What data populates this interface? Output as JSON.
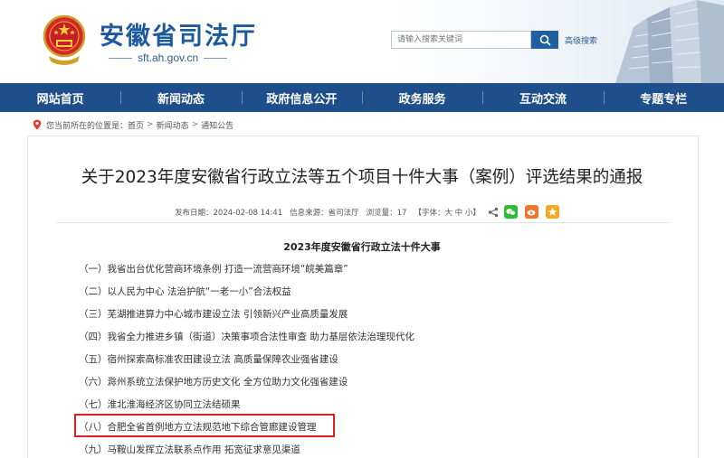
{
  "header": {
    "site_title": "安徽省司法厅",
    "site_url": "sft.ah.gov.cn",
    "search_placeholder": "请输入搜索关键词",
    "advanced_search": "高级搜索"
  },
  "nav": {
    "items": [
      "网站首页",
      "新闻动态",
      "政府信息公开",
      "政务服务",
      "互动交流",
      "专题专栏"
    ]
  },
  "breadcrumb": {
    "prefix": "您当前所在的位置是：",
    "items": [
      "首页",
      "新闻动态",
      "通知公告"
    ],
    "separator": ">"
  },
  "article": {
    "title": "关于2023年度安徽省行政立法等五个项目十件大事（案例）评选结果的通报",
    "publish_time": "发布日期：2024-02-08 14:41",
    "source": "信息来源：省司法厅",
    "views": "浏览量：17",
    "font_size": "【字体：大 中 小】",
    "section_heading": "2023年度安徽省行政立法十件大事",
    "items": [
      "（一）我省出台优化营商环境条例 打造一流营商环境“皖美篇章”",
      "（二）以人民为中心 法治护航“一老一小”合法权益",
      "（三）芜湖推进算力中心城市建设立法 引领新兴产业高质量发展",
      "（四）我省全力推进乡镇（街道）决策事项合法性审查 助力基层依法治理现代化",
      "（五）宿州探索高标准农田建设立法 高质量保障农业强省建设",
      "（六）滁州系统立法保护地方历史文化 全方位助力文化强省建设",
      "（七）淮北淮海经济区协同立法结硕果",
      "（八）合肥全省首例地方立法规范地下综合管廊建设管理",
      "（九）马鞍山发挥立法联系点作用 拓宽征求意见渠道"
    ],
    "highlighted_index": 7
  },
  "colors": {
    "brand_blue": "#1f4f8a",
    "title_blue": "#1b5a9e",
    "highlight_red": "#e02020",
    "wechat_green": "#2dbc3a",
    "weibo_orange": "#f0752a",
    "fav_yellow": "#f5a623"
  }
}
